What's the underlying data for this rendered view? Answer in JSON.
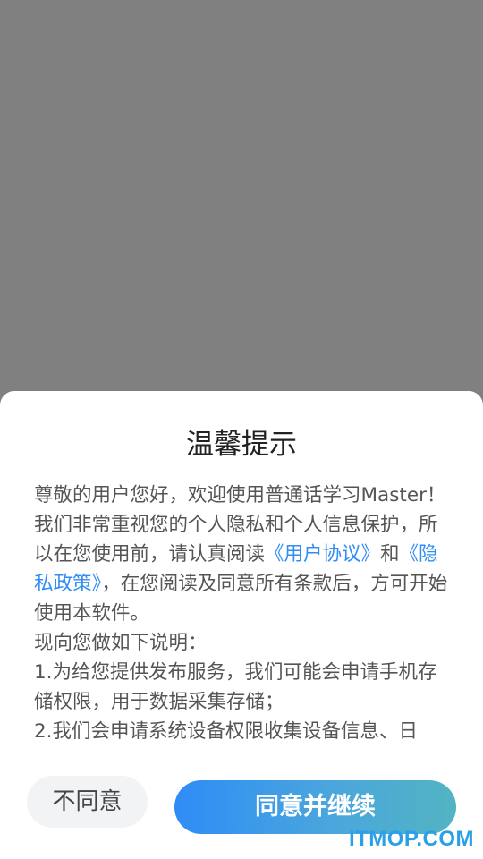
{
  "dialog": {
    "title": "温馨提示",
    "body": {
      "p1_prefix": "尊敬的用户您好，欢迎使用普通话学习Master！我们非常重视您的个人隐私和个人信息保护，所以在您使用前，请认真阅读",
      "user_agreement_link": "《用户协议》",
      "and_text": "和",
      "privacy_policy_link": "《隐私政策》",
      "p1_suffix": "，在您阅读及同意所有条款后，方可开始使用本软件。",
      "line2": "现向您做如下说明：",
      "item1": "1.为给您提供发布服务，我们可能会申请手机存储权限，用于数据采集存储；",
      "item2": "2.我们会申请系统设备权限收集设备信息、日"
    },
    "disagree_label": "不同意",
    "agree_label": "同意并继续"
  },
  "watermark": "ITMOP.COM",
  "colors": {
    "overlay": "#808080",
    "link": "#2f8df5",
    "agree_gradient_start": "#2e8cf6",
    "agree_gradient_end": "#52b4c2",
    "watermark": "#2aa0e8"
  }
}
